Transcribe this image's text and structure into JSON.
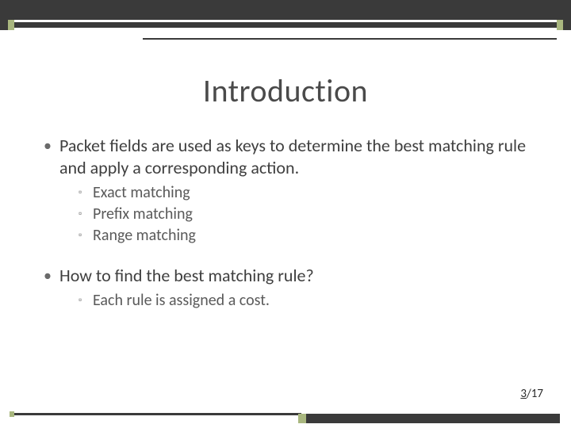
{
  "title": "Introduction",
  "bullets": [
    {
      "text": "Packet fields are used as keys to determine the best matching rule and apply a corresponding action.",
      "sub": [
        "Exact matching",
        "Prefix matching",
        "Range matching"
      ]
    },
    {
      "text": "How to find the best matching rule?",
      "sub": [
        "Each rule is assigned a cost."
      ]
    }
  ],
  "page": {
    "current": "3",
    "sep": "/",
    "total": "17"
  }
}
